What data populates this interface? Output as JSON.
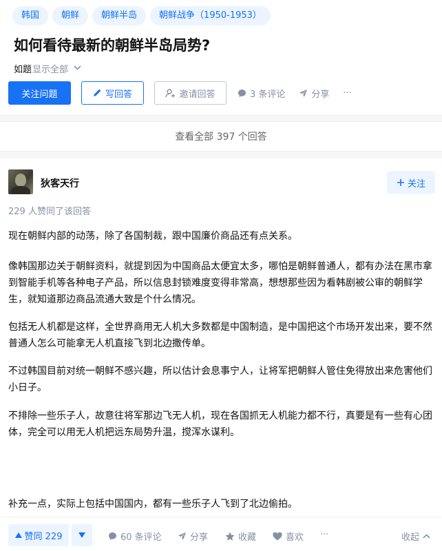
{
  "topics": [
    "韩国",
    "朝鲜",
    "朝鲜半岛",
    "朝鲜战争（1950-1953）"
  ],
  "question": {
    "title": "如何看待最新的朝鲜半岛局势?",
    "desc_text": "如题",
    "show_all": "显示全部"
  },
  "actions": {
    "follow_question": "关注问题",
    "write_answer": "写回答",
    "invite": "邀请回答",
    "comments": "3 条评论",
    "share": "分享",
    "more": "···"
  },
  "view_all": "查看全部 397 个回答",
  "answer": {
    "author": "狄客天行",
    "follow": "关注",
    "voters_text": "229 人赞同了该回答",
    "paragraphs": [
      "现在朝鲜内部的动荡，除了各国制裁，跟中国廉价商品还有点关系。",
      "像韩国那边关于朝鲜资料，就提到因为中国商品太便宜太多，哪怕是朝鲜普通人，都有办法在黑市拿到智能手机等各种电子产品，所以信息封锁难度变得非常高，想想那些因为看韩剧被公审的朝鲜学生，就知道那边商品流通大致是个什么情况。",
      "包括无人机都是这样，全世界商用无人机大多数都是中国制造，是中国把这个市场开发出来，要不然普通人怎么可能拿无人机直接飞到北边撒传单。",
      "不过韩国目前对统一朝鲜不感兴趣，所以估计会息事宁人，让将军把朝鲜人管住免得放出来危害他们小日子。",
      "不排除一些乐子人，故意往将军那边飞无人机，现在各国抓无人机能力都不行，真要是有一些有心团体，完全可以用无人机把远东局势升温，搅浑水谋利。",
      "补充一点，实际上包括中国国内，都有一些乐子人飞到了北边偷拍。"
    ]
  },
  "bottom_bar": {
    "upvote": "赞同 229",
    "comments": "60 条评论",
    "share": "分享",
    "favorite": "收藏",
    "like": "喜欢",
    "more": "···",
    "collapse": "收起"
  },
  "colors": {
    "brand_blue": "#1772f6",
    "tag_bg": "#ebf4ff",
    "meta_grey": "#8590a6",
    "page_bg": "#f6f6f6"
  },
  "icons": [
    "pencil-icon",
    "invite-user-icon",
    "comment-icon",
    "share-icon",
    "plus-icon",
    "upvote-triangle-icon",
    "downvote-triangle-icon",
    "star-icon",
    "heart-icon",
    "chevron-down-icon",
    "chevron-up-icon"
  ]
}
